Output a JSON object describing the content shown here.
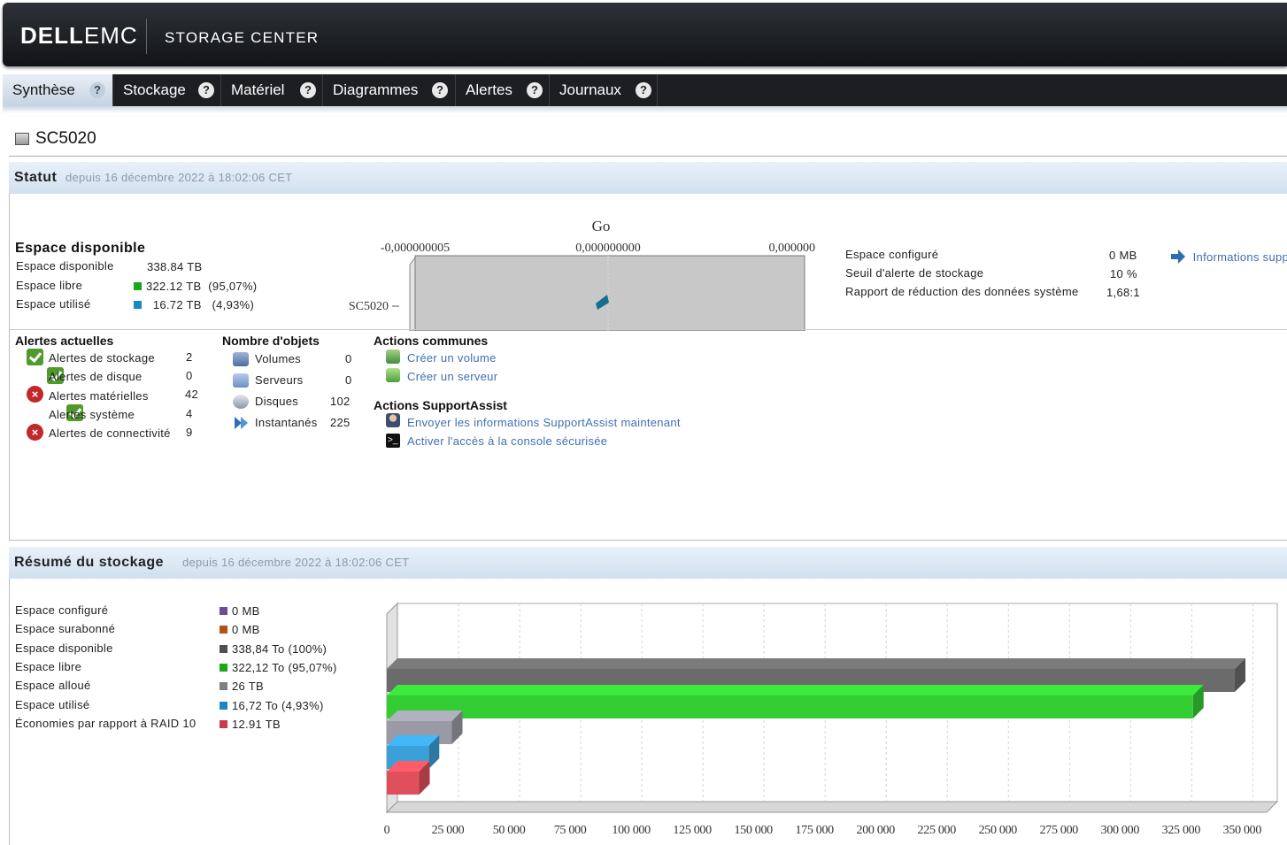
{
  "header": {
    "logo_dell": "DELL",
    "logo_emc": "EMC",
    "product": "STORAGE CENTER"
  },
  "tabs": [
    {
      "label": "Synthèse",
      "help": "?"
    },
    {
      "label": "Stockage",
      "help": "?"
    },
    {
      "label": "Matériel",
      "help": "?"
    },
    {
      "label": "Diagrammes",
      "help": "?"
    },
    {
      "label": "Alertes",
      "help": "?"
    },
    {
      "label": "Journaux",
      "help": "?"
    }
  ],
  "page": {
    "title": "SC5020"
  },
  "status": {
    "title": "Statut",
    "since": "depuis 16 décembre 2022 à 18:02:06 CET",
    "space": {
      "title": "Espace disponible",
      "rows": [
        {
          "label": "Espace disponible",
          "value": "338.84 TB",
          "pct": ""
        },
        {
          "label": "Espace libre",
          "value": "322.12 TB",
          "pct": "(95,07%)",
          "color": "#1aa81a"
        },
        {
          "label": "Espace utilisé",
          "value": "16.72 TB",
          "pct": "(4,93%)",
          "color": "#1b88c0"
        }
      ]
    },
    "gauge": {
      "unit": "Go",
      "ticks": [
        "-0,000000005",
        "0,000000000",
        "0,000000"
      ],
      "category": "SC5020"
    },
    "config": [
      {
        "label": "Espace configuré",
        "value": "0 MB"
      },
      {
        "label": "Seuil d'alerte de stockage",
        "value": "10 %"
      },
      {
        "label": "Rapport de réduction des données système",
        "value": "1,68:1"
      }
    ],
    "info_link": "Informations supp",
    "alerts": {
      "title": "Alertes actuelles",
      "items": [
        {
          "label": "Alertes de stockage",
          "count": "2",
          "state": "ok"
        },
        {
          "label": "Alertes de disque",
          "count": "0",
          "state": "ok"
        },
        {
          "label": "Alertes matérielles",
          "count": "42",
          "state": "error"
        },
        {
          "label": "Alertes système",
          "count": "4",
          "state": "ok"
        },
        {
          "label": "Alertes de connectivité",
          "count": "9",
          "state": "error"
        }
      ]
    },
    "objects": {
      "title": "Nombre d'objets",
      "items": [
        {
          "label": "Volumes",
          "count": "0",
          "icon": "volume-icon"
        },
        {
          "label": "Serveurs",
          "count": "0",
          "icon": "server-icon"
        },
        {
          "label": "Disques",
          "count": "102",
          "icon": "disk-icon"
        },
        {
          "label": "Instantanés",
          "count": "225",
          "icon": "snapshot-icon"
        }
      ]
    },
    "common_actions": {
      "title": "Actions communes",
      "items": [
        {
          "label": "Créer un volume",
          "icon": "create-volume-icon"
        },
        {
          "label": "Créer un serveur",
          "icon": "create-server-icon"
        }
      ]
    },
    "support_actions": {
      "title": "Actions SupportAssist",
      "items": [
        {
          "label": "Envoyer les informations SupportAssist maintenant",
          "icon": "supportassist-icon"
        },
        {
          "label": "Activer l'accès à la console sécurisée",
          "icon": "console-icon"
        }
      ]
    }
  },
  "storage_summary": {
    "title": "Résumé du stockage",
    "since": "depuis 16 décembre 2022 à 18:02:06 CET",
    "legend": [
      {
        "label": "Espace configuré",
        "value": "0 MB",
        "color": "#6a4c9c"
      },
      {
        "label": "Espace surabonné",
        "value": "0 MB",
        "color": "#b5501a"
      },
      {
        "label": "Espace disponible",
        "value": "338,84 To (100%)",
        "color": "#505050"
      },
      {
        "label": "Espace libre",
        "value": "322,12 To (95,07%)",
        "color": "#1aa81a"
      },
      {
        "label": "Espace alloué",
        "value": "26 TB",
        "color": "#7f7f7f"
      },
      {
        "label": "Espace utilisé",
        "value": "16,72 To (4,93%)",
        "color": "#1b88c0"
      },
      {
        "label": "Économies par rapport à RAID 10",
        "value": "12.91 TB",
        "color": "#c83c48"
      }
    ]
  },
  "chart_data": {
    "type": "bar",
    "orientation": "horizontal",
    "categories": [
      "Espace disponible",
      "Espace libre",
      "Espace alloué",
      "Espace utilisé",
      "Économies par rapport à RAID 10"
    ],
    "values": [
      346970,
      329851,
      26624,
      17121,
      13220
    ],
    "colors": [
      "#6b6b6b",
      "#33cc33",
      "#9a9aa6",
      "#3aa0d8",
      "#e0505c"
    ],
    "xlim": [
      0,
      360000
    ],
    "xticks": [
      0,
      25000,
      50000,
      75000,
      100000,
      125000,
      150000,
      175000,
      200000,
      225000,
      250000,
      275000,
      300000,
      325000,
      350000
    ],
    "xtick_labels": [
      "0",
      "25 000",
      "50 000",
      "75 000",
      "100 000",
      "125 000",
      "150 000",
      "175 000",
      "200 000",
      "225 000",
      "250 000",
      "275 000",
      "300 000",
      "325 000",
      "350 000"
    ],
    "grid": true
  }
}
